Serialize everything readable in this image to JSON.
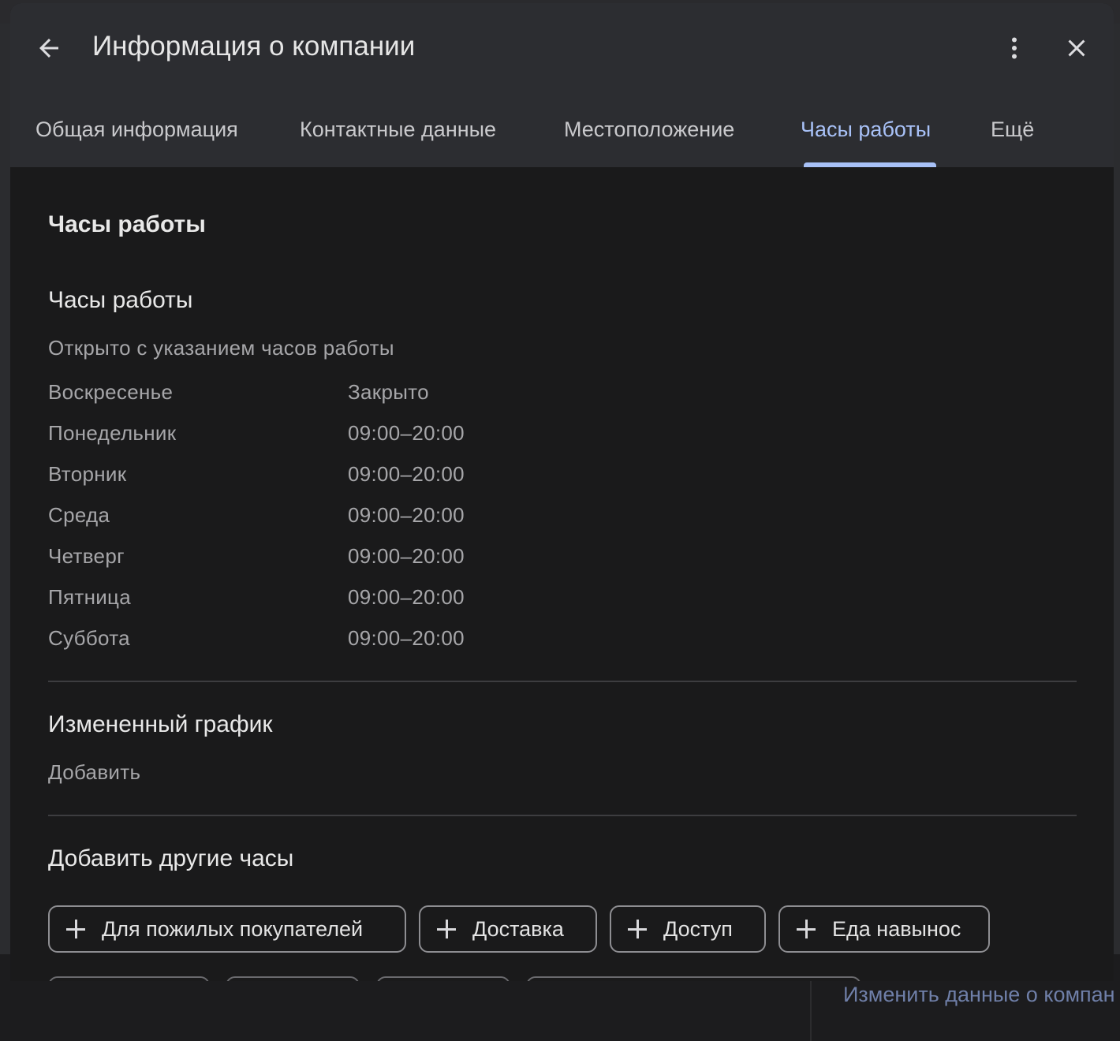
{
  "background": {
    "edit_link": "Изменить данные о компан"
  },
  "dialog": {
    "title": "Информация о компании",
    "back_icon": "arrow-left-icon",
    "more_icon": "more-vertical-icon",
    "close_icon": "close-icon",
    "tabs": [
      {
        "label": "Общая информация",
        "active": false
      },
      {
        "label": "Контактные данные",
        "active": false
      },
      {
        "label": "Местоположение",
        "active": false
      },
      {
        "label": "Часы работы",
        "active": true
      },
      {
        "label": "Ещё",
        "active": false
      }
    ]
  },
  "hours_section": {
    "title": "Часы работы",
    "subtitle": "Часы работы",
    "status": "Открыто с указанием часов работы",
    "schedule": [
      {
        "day": "Воскресенье",
        "hours": "Закрыто"
      },
      {
        "day": "Понедельник",
        "hours": "09:00–20:00"
      },
      {
        "day": "Вторник",
        "hours": "09:00–20:00"
      },
      {
        "day": "Среда",
        "hours": "09:00–20:00"
      },
      {
        "day": "Четверг",
        "hours": "09:00–20:00"
      },
      {
        "day": "Пятница",
        "hours": "09:00–20:00"
      },
      {
        "day": "Суббота",
        "hours": "09:00–20:00"
      }
    ]
  },
  "special_hours": {
    "title": "Измененный график",
    "add_label": "Добавить"
  },
  "other_hours": {
    "title": "Добавить другие часы",
    "chips": [
      "Для пожилых покупателей",
      "Доставка",
      "Доступ",
      "Еда навынос"
    ]
  },
  "colors": {
    "accent": "#a8c1f7",
    "header_bg": "#2c2d31",
    "dialog_bg": "#1a1a1b"
  }
}
